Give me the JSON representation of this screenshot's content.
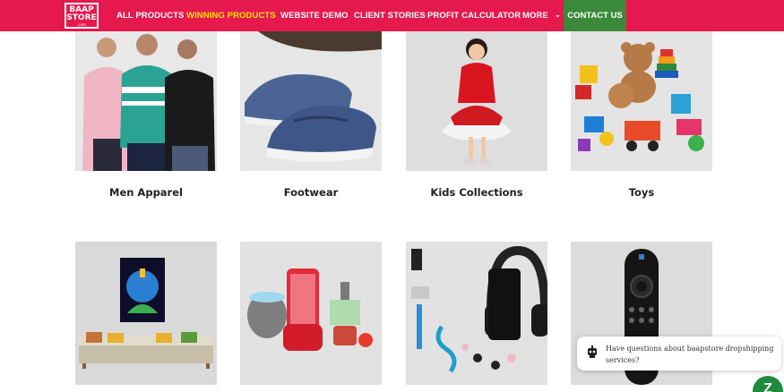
{
  "logo": {
    "line1": "BAAP",
    "line2": "STORE",
    "sub": ".com"
  },
  "nav": {
    "items": [
      {
        "label": "ALL PRODUCTS"
      },
      {
        "label": "WINNING PRODUCTS"
      },
      {
        "label": "WEBSITE DEMO"
      },
      {
        "label": "CLIENT STORIES"
      },
      {
        "label": "PROFIT CALCULATOR"
      },
      {
        "label": "MORE"
      }
    ],
    "contact": "CONTACT US",
    "colors": {
      "bar": "#e5194d",
      "active": "#ffe600",
      "contact": "#3b8a3a"
    }
  },
  "categories": [
    {
      "label": "Men Apparel"
    },
    {
      "label": "Footwear"
    },
    {
      "label": "Kids Collections"
    },
    {
      "label": "Toys"
    }
  ],
  "chat": {
    "message": "Have questions about baapstore dropshipping services?",
    "launcher_glyph": "Z",
    "icon": "robot-icon"
  }
}
